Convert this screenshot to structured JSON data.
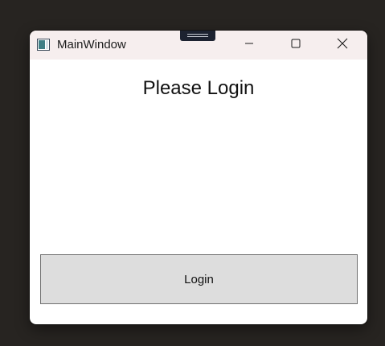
{
  "window": {
    "title": "MainWindow",
    "icon": "app-window-icon"
  },
  "titlebar_buttons": {
    "minimize_icon": "minimize-icon",
    "maximize_icon": "maximize-icon",
    "close_icon": "close-icon"
  },
  "content": {
    "heading": "Please Login",
    "login_button_label": "Login"
  },
  "colors": {
    "desktop_background": "#272421",
    "titlebar_background": "#f6eeee",
    "window_background": "#ffffff",
    "button_background": "#dddddd",
    "button_border": "#707070"
  }
}
